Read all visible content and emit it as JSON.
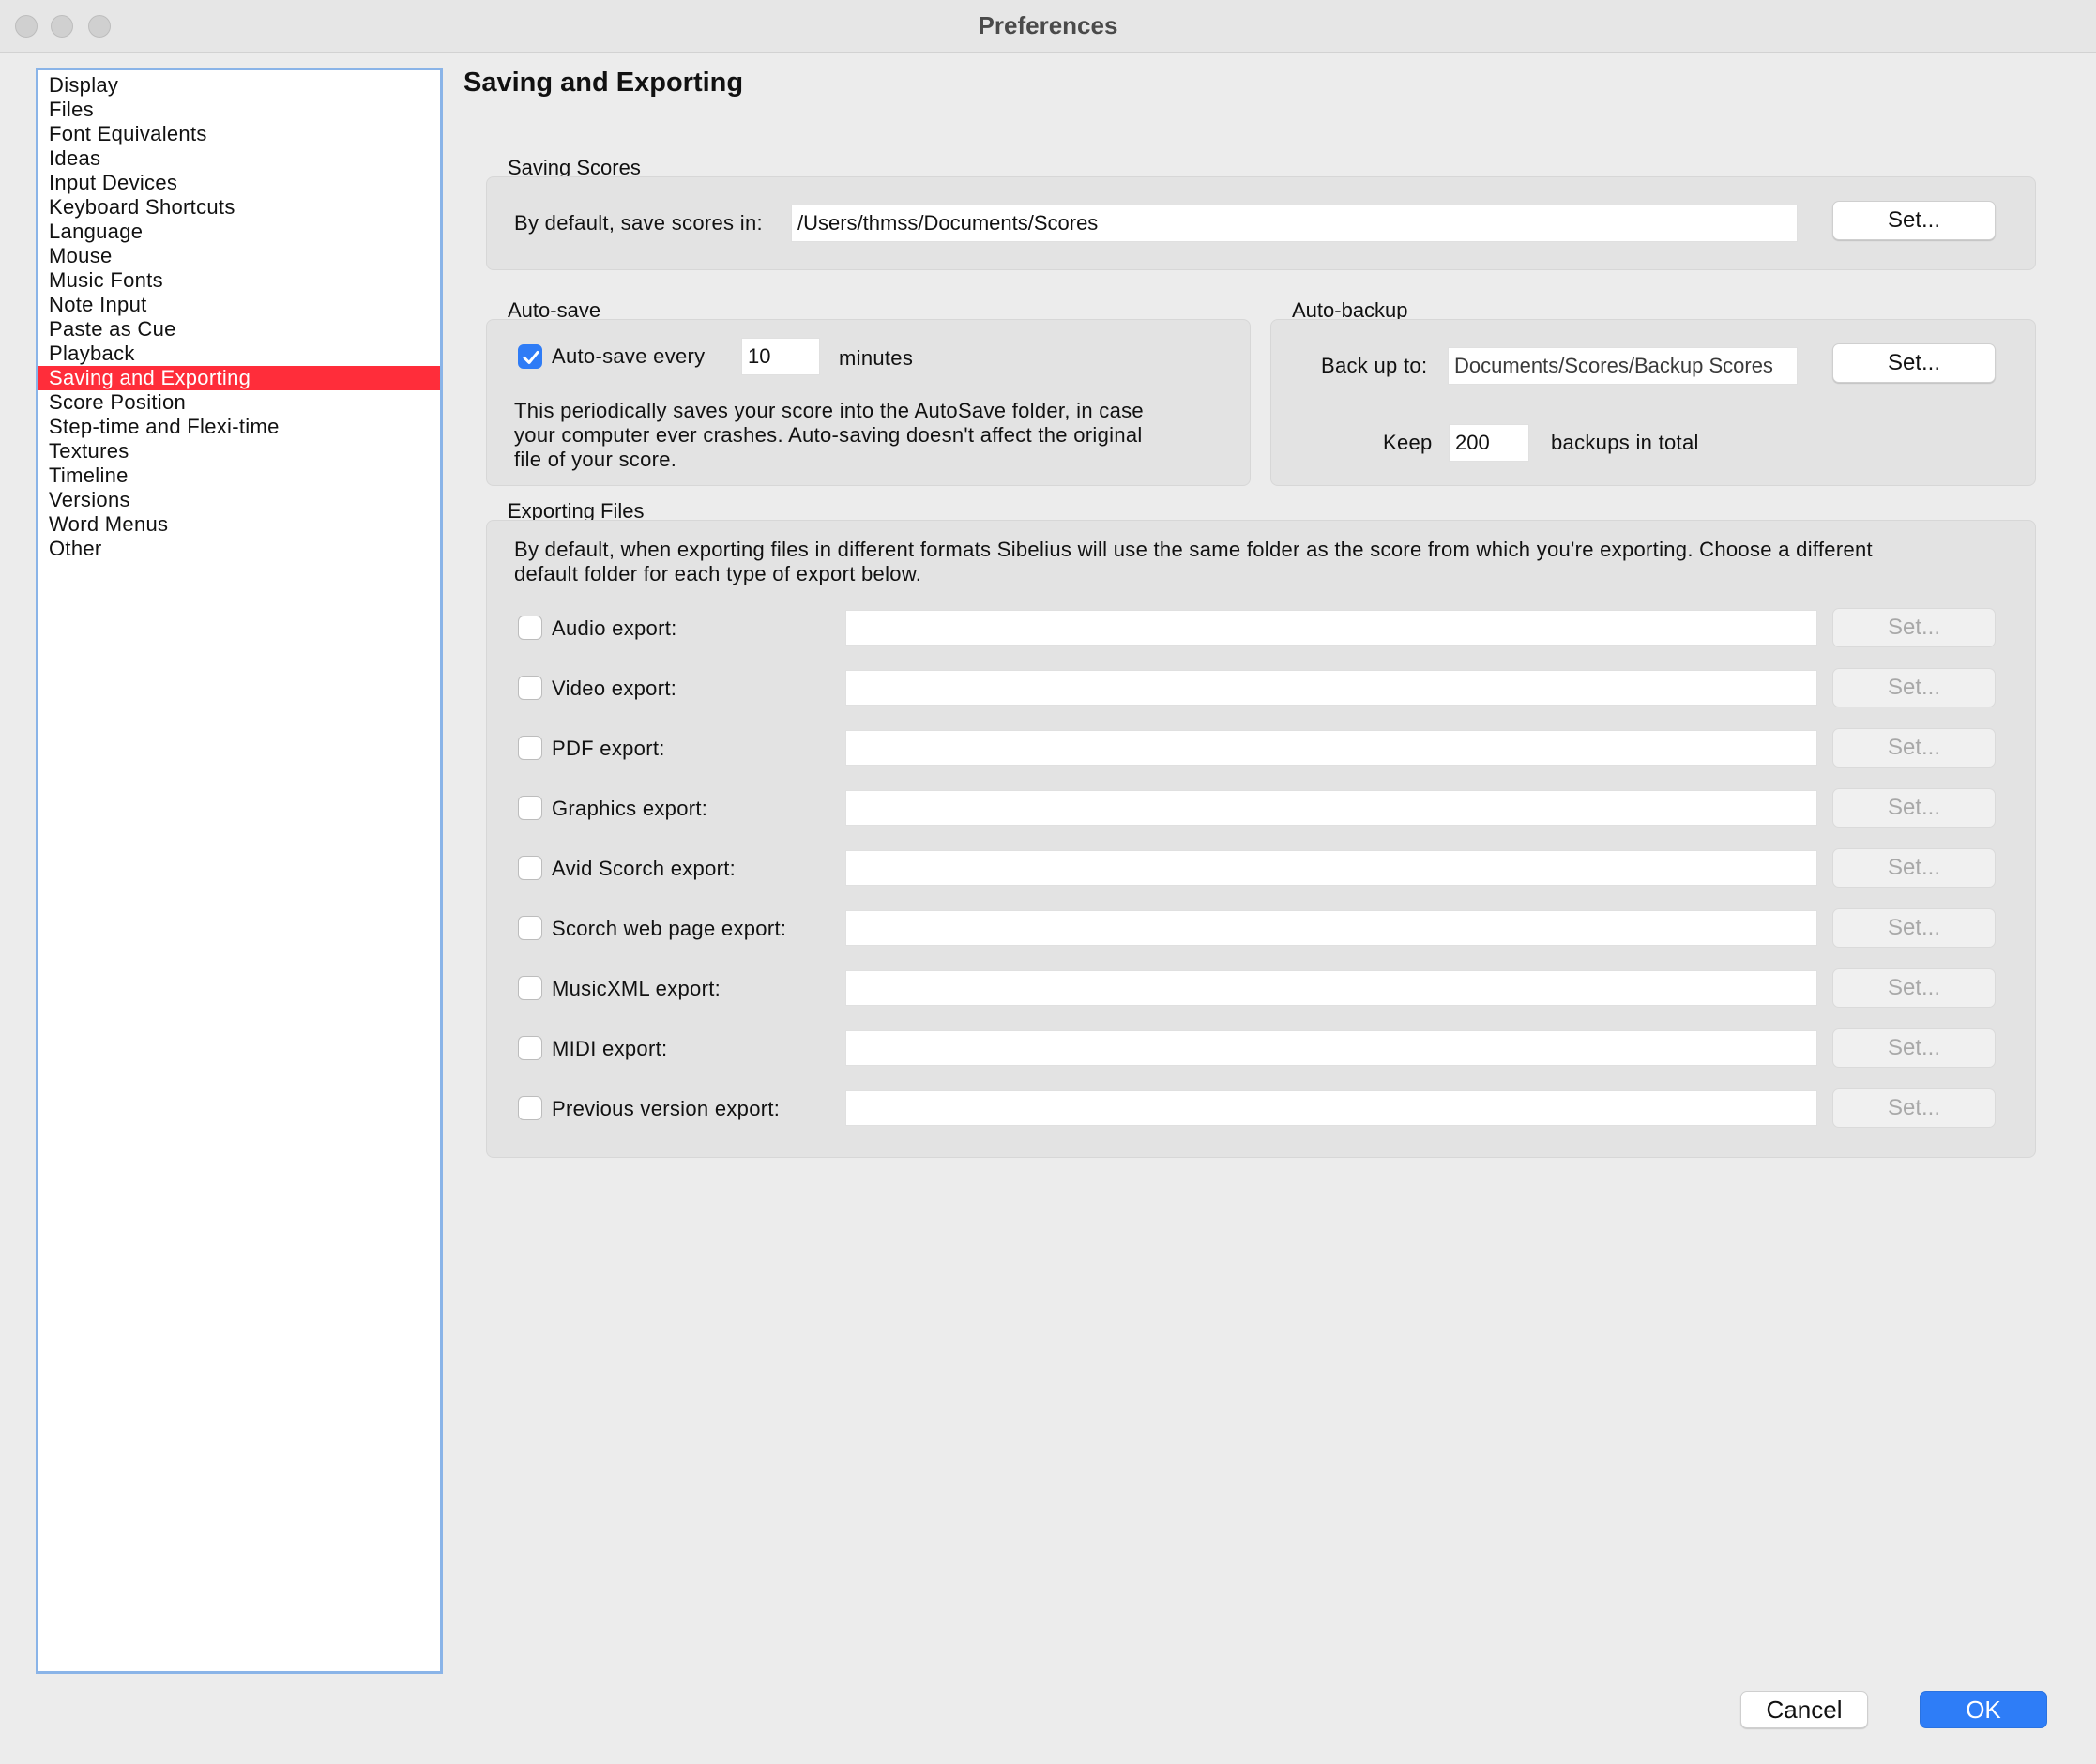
{
  "window": {
    "title": "Preferences"
  },
  "sidebar": {
    "items": [
      {
        "label": "Display"
      },
      {
        "label": "Files"
      },
      {
        "label": "Font Equivalents"
      },
      {
        "label": "Ideas"
      },
      {
        "label": "Input Devices"
      },
      {
        "label": "Keyboard Shortcuts"
      },
      {
        "label": "Language"
      },
      {
        "label": "Mouse"
      },
      {
        "label": "Music Fonts"
      },
      {
        "label": "Note Input"
      },
      {
        "label": "Paste as Cue"
      },
      {
        "label": "Playback"
      },
      {
        "label": "Saving and Exporting",
        "selected": true
      },
      {
        "label": "Score Position"
      },
      {
        "label": "Step-time and Flexi-time"
      },
      {
        "label": "Textures"
      },
      {
        "label": "Timeline"
      },
      {
        "label": "Versions"
      },
      {
        "label": "Word Menus"
      },
      {
        "label": "Other"
      }
    ]
  },
  "main": {
    "heading": "Saving and Exporting",
    "saving_scores": {
      "label": "Saving Scores",
      "field_label": "By default, save scores in:",
      "path": "/Users/thmss/Documents/Scores",
      "button": "Set..."
    },
    "auto_save": {
      "label": "Auto-save",
      "checkbox_label": "Auto-save every",
      "checked": true,
      "minutes_value": "10",
      "minutes_label": "minutes",
      "description_lines": [
        "This periodically saves your score into the AutoSave folder, in case",
        "your computer ever crashes. Auto-saving doesn't affect the original",
        "file of your score."
      ]
    },
    "auto_backup": {
      "label": "Auto-backup",
      "back_up_label": "Back up to:",
      "path": "Documents/Scores/Backup Scores",
      "button": "Set...",
      "keep_label": "Keep",
      "keep_value": "200",
      "keep_suffix": "backups in total"
    },
    "exporting": {
      "label": "Exporting Files",
      "description_lines": [
        "By default, when exporting files in different formats Sibelius will use the same folder as the score from which you're exporting. Choose a different",
        "default folder for each type of export below."
      ],
      "button": "Set...",
      "rows": [
        {
          "label": "Audio export:",
          "value": "",
          "checked": false
        },
        {
          "label": "Video export:",
          "value": "",
          "checked": false
        },
        {
          "label": "PDF export:",
          "value": "",
          "checked": false
        },
        {
          "label": "Graphics export:",
          "value": "",
          "checked": false
        },
        {
          "label": "Avid Scorch export:",
          "value": "",
          "checked": false
        },
        {
          "label": "Scorch web page export:",
          "value": "",
          "checked": false
        },
        {
          "label": "MusicXML export:",
          "value": "",
          "checked": false
        },
        {
          "label": "MIDI export:",
          "value": "",
          "checked": false
        },
        {
          "label": "Previous version export:",
          "value": "",
          "checked": false
        }
      ]
    }
  },
  "footer": {
    "cancel": "Cancel",
    "ok": "OK"
  },
  "colors": {
    "selection": "#ff2d3a",
    "accent": "#2e7df7"
  }
}
